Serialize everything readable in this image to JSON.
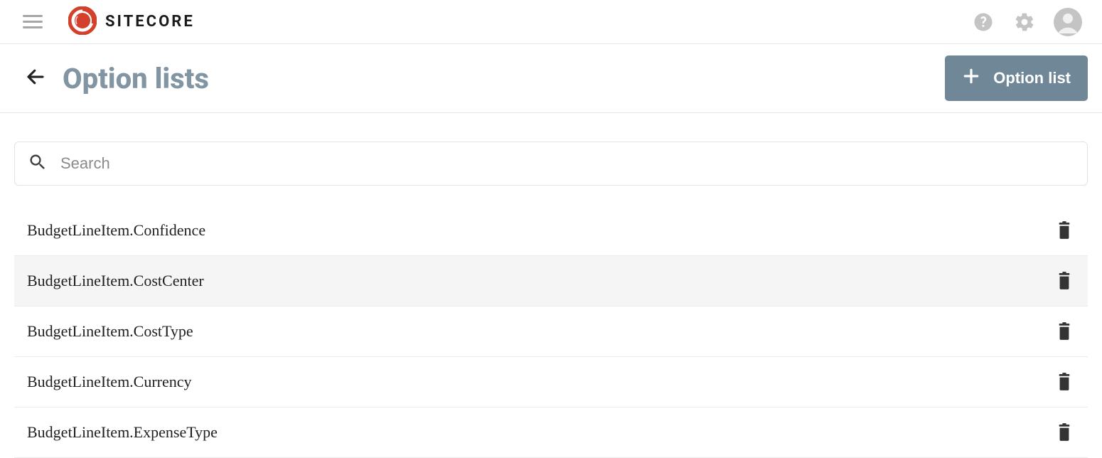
{
  "brand": "SITECORE",
  "page_title": "Option lists",
  "primary_button_label": "Option list",
  "search": {
    "placeholder": "Search",
    "value": ""
  },
  "rows": [
    {
      "name": "BudgetLineItem.Confidence",
      "highlight": false
    },
    {
      "name": "BudgetLineItem.CostCenter",
      "highlight": true
    },
    {
      "name": "BudgetLineItem.CostType",
      "highlight": false
    },
    {
      "name": "BudgetLineItem.Currency",
      "highlight": false
    },
    {
      "name": "BudgetLineItem.ExpenseType",
      "highlight": false
    }
  ],
  "icons": {
    "hamburger": "hamburger-icon",
    "help": "help-icon",
    "settings": "gear-icon",
    "avatar": "user-avatar-icon",
    "back": "arrow-left-icon",
    "plus": "plus-icon",
    "search": "search-icon",
    "delete": "trash-icon"
  },
  "colors": {
    "accent": "#6f8796",
    "title": "#8295a3",
    "logo": "#d3412c"
  }
}
